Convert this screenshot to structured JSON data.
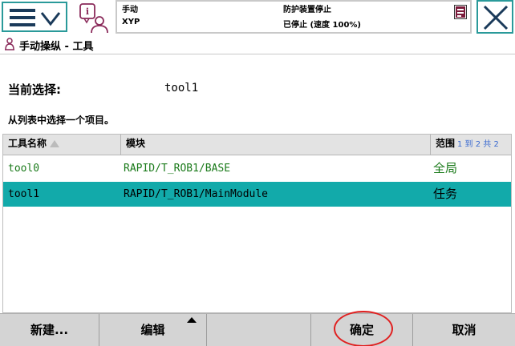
{
  "status": {
    "mode": "手动",
    "system": "XYP",
    "safety": "防护装置停止",
    "state": "已停止 (速度 100%)"
  },
  "title": "手动操纵 - 工具",
  "selection": {
    "label": "当前选择:",
    "value": "tool1"
  },
  "instruction": "从列表中选择一个项目。",
  "table": {
    "headers": {
      "name": "工具名称",
      "module": "模块",
      "scope": "范围",
      "count": "1 到 2 共 2"
    },
    "rows": [
      {
        "name": "tool0",
        "module": "RAPID/T_ROB1/BASE",
        "scope": "全局",
        "selected": false
      },
      {
        "name": "tool1",
        "module": "RAPID/T_ROB1/MainModule",
        "scope": "任务",
        "selected": true
      }
    ]
  },
  "buttons": {
    "new": "新建...",
    "edit": "编辑",
    "ok": "确定",
    "cancel": "取消"
  },
  "colors": {
    "accent": "#12aaaa",
    "frame": "#2a9a9a",
    "global_row_text": "#1a7a1a",
    "highlight_oval": "#e02020"
  }
}
